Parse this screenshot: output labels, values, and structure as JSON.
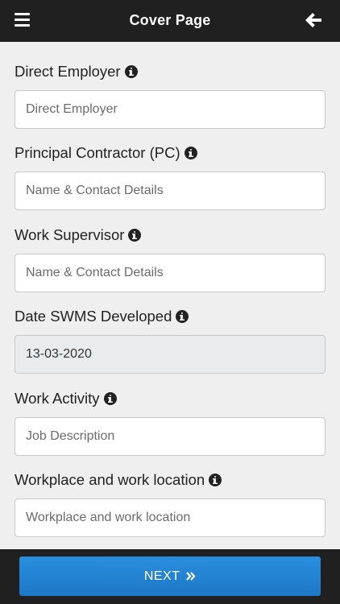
{
  "header": {
    "title": "Cover Page",
    "menu_icon": "hamburger-menu-icon",
    "back_icon": "arrow-left-icon"
  },
  "form": {
    "fields": [
      {
        "label": "Direct Employer",
        "placeholder": "Direct Employer",
        "value": ""
      },
      {
        "label": "Principal Contractor (PC)",
        "placeholder": "Name & Contact Details",
        "value": ""
      },
      {
        "label": "Work Supervisor",
        "placeholder": "Name & Contact Details",
        "value": ""
      },
      {
        "label": "Date SWMS Developed",
        "placeholder": "",
        "value": "13-03-2020"
      },
      {
        "label": "Work Activity",
        "placeholder": "Job Description",
        "value": ""
      },
      {
        "label": "Workplace and work location",
        "placeholder": "Workplace and work location",
        "value": ""
      }
    ]
  },
  "footer": {
    "next_label": "NEXT",
    "next_icon": "double-chevron-right-icon"
  },
  "colors": {
    "header_bg": "#202020",
    "page_bg": "#efefef",
    "button_blue": "#1d78c6"
  }
}
